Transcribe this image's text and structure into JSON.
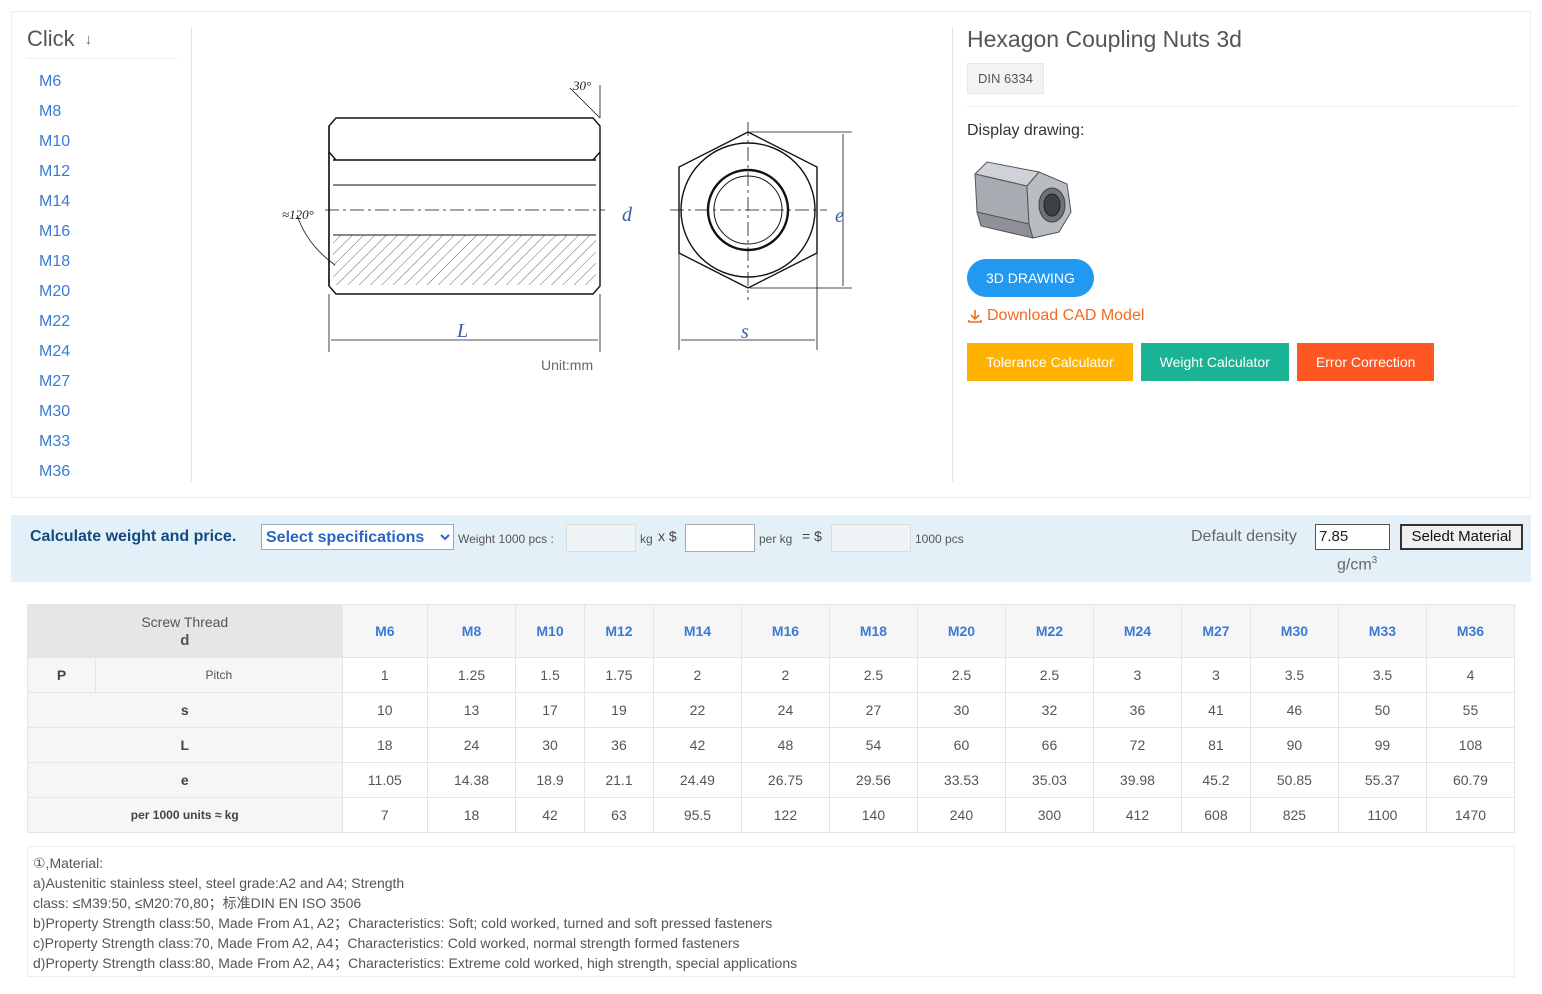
{
  "sidebar": {
    "header": "Click",
    "header_icon": "arrow-down-icon",
    "sizes": [
      "M6",
      "M8",
      "M10",
      "M12",
      "M14",
      "M16",
      "M18",
      "M20",
      "M22",
      "M24",
      "M27",
      "M30",
      "M33",
      "M36"
    ]
  },
  "drawing": {
    "angle_top": "30°",
    "angle_side": "≈120°",
    "dim_d": "d",
    "dim_e": "e",
    "dim_L": "L",
    "dim_s": "s",
    "unit": "Unit:mm"
  },
  "product": {
    "title": "Hexagon Coupling Nuts 3d",
    "standard": "DIN 6334",
    "display_label": "Display drawing:",
    "btn_3d": "3D DRAWING",
    "download": "Download CAD Model",
    "buttons": [
      "Tolerance Calculator",
      "Weight Calculator",
      "Error Correction"
    ]
  },
  "calculator": {
    "title": "Calculate weight and price.",
    "select_placeholder": "Select specifications",
    "weight_label": "Weight 1000 pcs :",
    "kg_x": "kg",
    "x_dollar": "x $",
    "per_kg": "per kg",
    "eq_dollar": "= $",
    "pcs": "1000 pcs",
    "density_label": "Default density",
    "density_value": "7.85",
    "density_unit": "g/cm",
    "density_unit_sup": "3",
    "material_button": "Seledt Material"
  },
  "table": {
    "corner_top": "Screw Thread",
    "corner_bottom": "d",
    "columns": [
      "M6",
      "M8",
      "M10",
      "M12",
      "M14",
      "M16",
      "M18",
      "M20",
      "M22",
      "M24",
      "M27",
      "M30",
      "M33",
      "M36"
    ],
    "rows": [
      {
        "label": "P",
        "sub": "Pitch",
        "values": [
          "1",
          "1.25",
          "1.5",
          "1.75",
          "2",
          "2",
          "2.5",
          "2.5",
          "2.5",
          "3",
          "3",
          "3.5",
          "3.5",
          "4"
        ]
      },
      {
        "label": "s",
        "sub": "",
        "values": [
          "10",
          "13",
          "17",
          "19",
          "22",
          "24",
          "27",
          "30",
          "32",
          "36",
          "41",
          "46",
          "50",
          "55"
        ]
      },
      {
        "label": "L",
        "sub": "",
        "values": [
          "18",
          "24",
          "30",
          "36",
          "42",
          "48",
          "54",
          "60",
          "66",
          "72",
          "81",
          "90",
          "99",
          "108"
        ]
      },
      {
        "label": "e",
        "sub": "",
        "values": [
          "11.05",
          "14.38",
          "18.9",
          "21.1",
          "24.49",
          "26.75",
          "29.56",
          "33.53",
          "35.03",
          "39.98",
          "45.2",
          "50.85",
          "55.37",
          "60.79"
        ]
      },
      {
        "label": "per 1000 units ≈ kg",
        "sub": "",
        "values": [
          "7",
          "18",
          "42",
          "63",
          "95.5",
          "122",
          "140",
          "240",
          "300",
          "412",
          "608",
          "825",
          "1100",
          "1470"
        ]
      }
    ]
  },
  "notes": [
    "①,Material:",
    "a)Austenitic stainless steel, steel grade:A2 and A4; Strength",
    "class: ≤M39:50, ≤M20:70,80；标准DIN EN ISO 3506",
    "b)Property Strength class:50, Made From A1, A2；Characteristics: Soft; cold worked, turned and soft pressed fasteners",
    "c)Property Strength class:70, Made From A2, A4；Characteristics: Cold worked, normal strength formed fasteners",
    "d)Property Strength class:80, Made From A2, A4；Characteristics: Extreme cold worked, high strength, special applications"
  ]
}
